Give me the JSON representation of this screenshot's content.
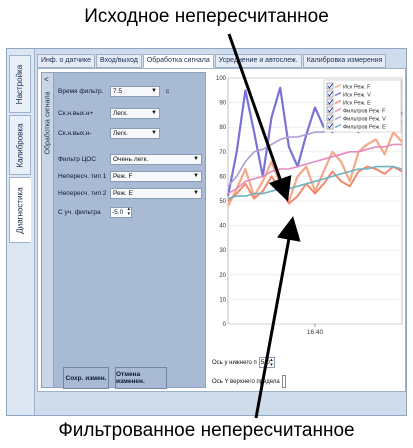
{
  "annotations": {
    "top": "Исходное непересчитанное",
    "bottom": "Фильтрованное непересчитанное"
  },
  "sidebar": {
    "tabs": [
      {
        "label": "Настройка"
      },
      {
        "label": "Калибровка"
      },
      {
        "label": "Диагностика"
      }
    ]
  },
  "tabs": [
    {
      "label": "Инф. о датчике"
    },
    {
      "label": "Вход/выход"
    },
    {
      "label": "Обработка сигнала"
    },
    {
      "label": "Усреднение и автослеж."
    },
    {
      "label": "Калибровка измерения"
    }
  ],
  "panel": {
    "side_label": "Обработка сигнала",
    "collapse_glyph": "<",
    "filter_time": {
      "label": "Время фильтр.",
      "value": "7.5",
      "unit": "с"
    },
    "sk_out_plus": {
      "label": "Ск.н.вых.н+",
      "value": "Легк."
    },
    "sk_out_minus": {
      "label": "Ск.н.вых.н-",
      "value": "Легк."
    },
    "dsp_filter": {
      "label": "Фильтр ЦОС",
      "value": "Очень легк."
    },
    "nonrecalc_type1": {
      "label": "Непересч. тип 1",
      "value": "Реж. F"
    },
    "nonrecalc_type2": {
      "label": "Непересч. тип 2",
      "value": "Реж. E"
    },
    "filter_coef": {
      "label": "С уч. фильтра",
      "value": "-5.0"
    },
    "save_label": "Сохр. измен.",
    "cancel_label": "Отмена изменен."
  },
  "axis_controls": {
    "lower_label": "Ось у нижнего п",
    "lower_value": "5.0",
    "upper_label": "Ось Y верхнего предела"
  },
  "colors": {
    "raw_f": "#f4a98a",
    "raw_v": "#7b72d6",
    "raw_e": "#f08a6e",
    "filt_f": "#e58ac1",
    "filt_v": "#b19ad8",
    "filt_e": "#6fb3c2"
  },
  "chart_data": {
    "type": "line",
    "title": "",
    "xlabel": "",
    "ylabel": "",
    "ylim": [
      0,
      100
    ],
    "yticks": [
      0,
      10,
      20,
      30,
      40,
      50,
      60,
      70,
      80,
      90,
      100
    ],
    "xtick_label": "16:40",
    "grid": true,
    "legend_position": "top-right",
    "x": [
      0,
      1,
      2,
      3,
      4,
      5,
      6,
      7,
      8,
      9,
      10,
      11,
      12,
      13,
      14,
      15,
      16,
      17,
      18,
      19,
      20
    ],
    "series": [
      {
        "name": "Исх Реж. F",
        "values": [
          48,
          55,
          63,
          52,
          58,
          66,
          57,
          50,
          60,
          64,
          54,
          62,
          70,
          66,
          58,
          70,
          73,
          75,
          69,
          78,
          74
        ]
      },
      {
        "name": "Исх Реж. V",
        "values": [
          52,
          70,
          95,
          78,
          60,
          84,
          96,
          72,
          64,
          77,
          88,
          80,
          78,
          82,
          86,
          78,
          92,
          84,
          88,
          82,
          86
        ]
      },
      {
        "name": "Исх Реж. E",
        "values": [
          50,
          53,
          57,
          51,
          54,
          60,
          55,
          49,
          52,
          57,
          53,
          57,
          62,
          58,
          56,
          62,
          64,
          63,
          61,
          64,
          62
        ]
      },
      {
        "name": "Фильтров Реж. F",
        "values": [
          53,
          55,
          58,
          59,
          60,
          62,
          63,
          63,
          64,
          65,
          66,
          67,
          68,
          69,
          70,
          70,
          71,
          72,
          72,
          73,
          73
        ]
      },
      {
        "name": "Фильтров Реж. V",
        "values": [
          56,
          60,
          66,
          70,
          71,
          73,
          75,
          76,
          76,
          77,
          78,
          78,
          79,
          79,
          80,
          80,
          81,
          81,
          82,
          82,
          82
        ]
      },
      {
        "name": "Фильтров Реж. E",
        "values": [
          51,
          52,
          52,
          53,
          53,
          54,
          55,
          55,
          56,
          57,
          58,
          59,
          60,
          61,
          62,
          63,
          63,
          64,
          64,
          64,
          63
        ]
      }
    ]
  }
}
